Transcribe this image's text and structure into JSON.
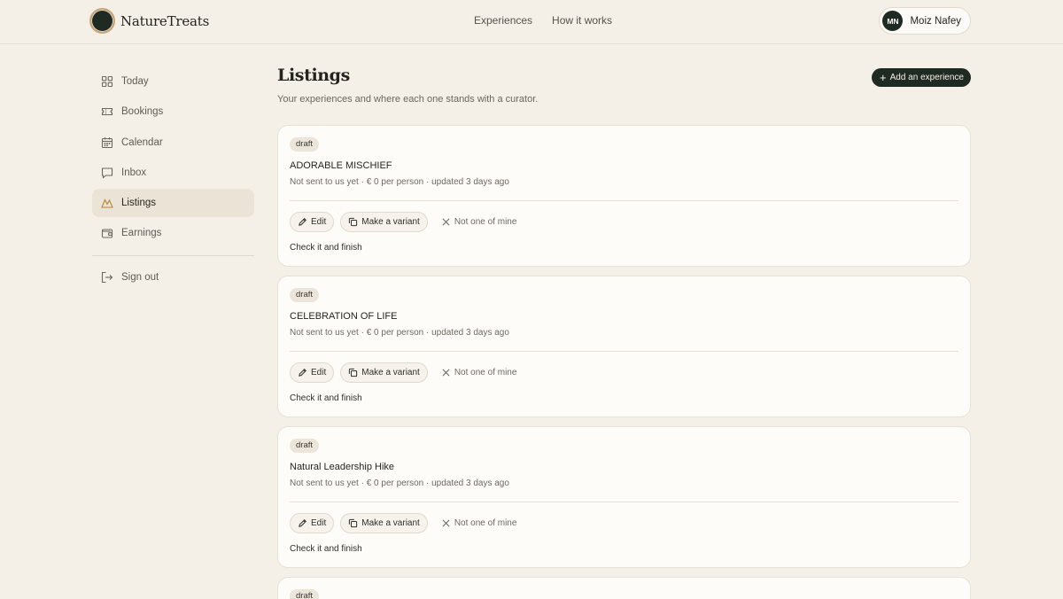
{
  "brand": {
    "name": "NatureTreats"
  },
  "topnav": {
    "items": [
      "Experiences",
      "How it works"
    ]
  },
  "user": {
    "initials": "MN",
    "name": "Moiz Nafey"
  },
  "sidebar": {
    "items": [
      {
        "label": "Today",
        "icon": "grid-icon"
      },
      {
        "label": "Bookings",
        "icon": "ticket-icon"
      },
      {
        "label": "Calendar",
        "icon": "calendar-icon"
      },
      {
        "label": "Inbox",
        "icon": "message-icon"
      },
      {
        "label": "Listings",
        "icon": "mountain-icon",
        "active": true
      },
      {
        "label": "Earnings",
        "icon": "wallet-icon"
      }
    ],
    "signout": {
      "label": "Sign out",
      "icon": "sign-out-icon"
    }
  },
  "main": {
    "title": "Listings",
    "subtitle": "Your experiences and where each one stands with a curator.",
    "add_button": "Add an experience"
  },
  "listings": [
    {
      "status": "draft",
      "title": "ADORABLE MISCHIEF",
      "meta": "Not sent to us yet · € 0 per person · updated 3 days ago",
      "edit": "Edit",
      "variant": "Make a variant",
      "dismiss": "Not one of mine",
      "footer": "Check it and finish"
    },
    {
      "status": "draft",
      "title": "CELEBRATION OF LIFE",
      "meta": "Not sent to us yet · € 0 per person · updated 3 days ago",
      "edit": "Edit",
      "variant": "Make a variant",
      "dismiss": "Not one of mine",
      "footer": "Check it and finish"
    },
    {
      "status": "draft",
      "title": "Natural Leadership Hike",
      "meta": "Not sent to us yet · € 0 per person · updated 3 days ago",
      "edit": "Edit",
      "variant": "Make a variant",
      "dismiss": "Not one of mine",
      "footer": "Check it and finish"
    },
    {
      "status": "draft"
    }
  ],
  "colors": {
    "accent": "#1f2a22",
    "background": "#f5f0e7",
    "card": "#fdfcf9",
    "active_nav": "#ebe3d6"
  }
}
